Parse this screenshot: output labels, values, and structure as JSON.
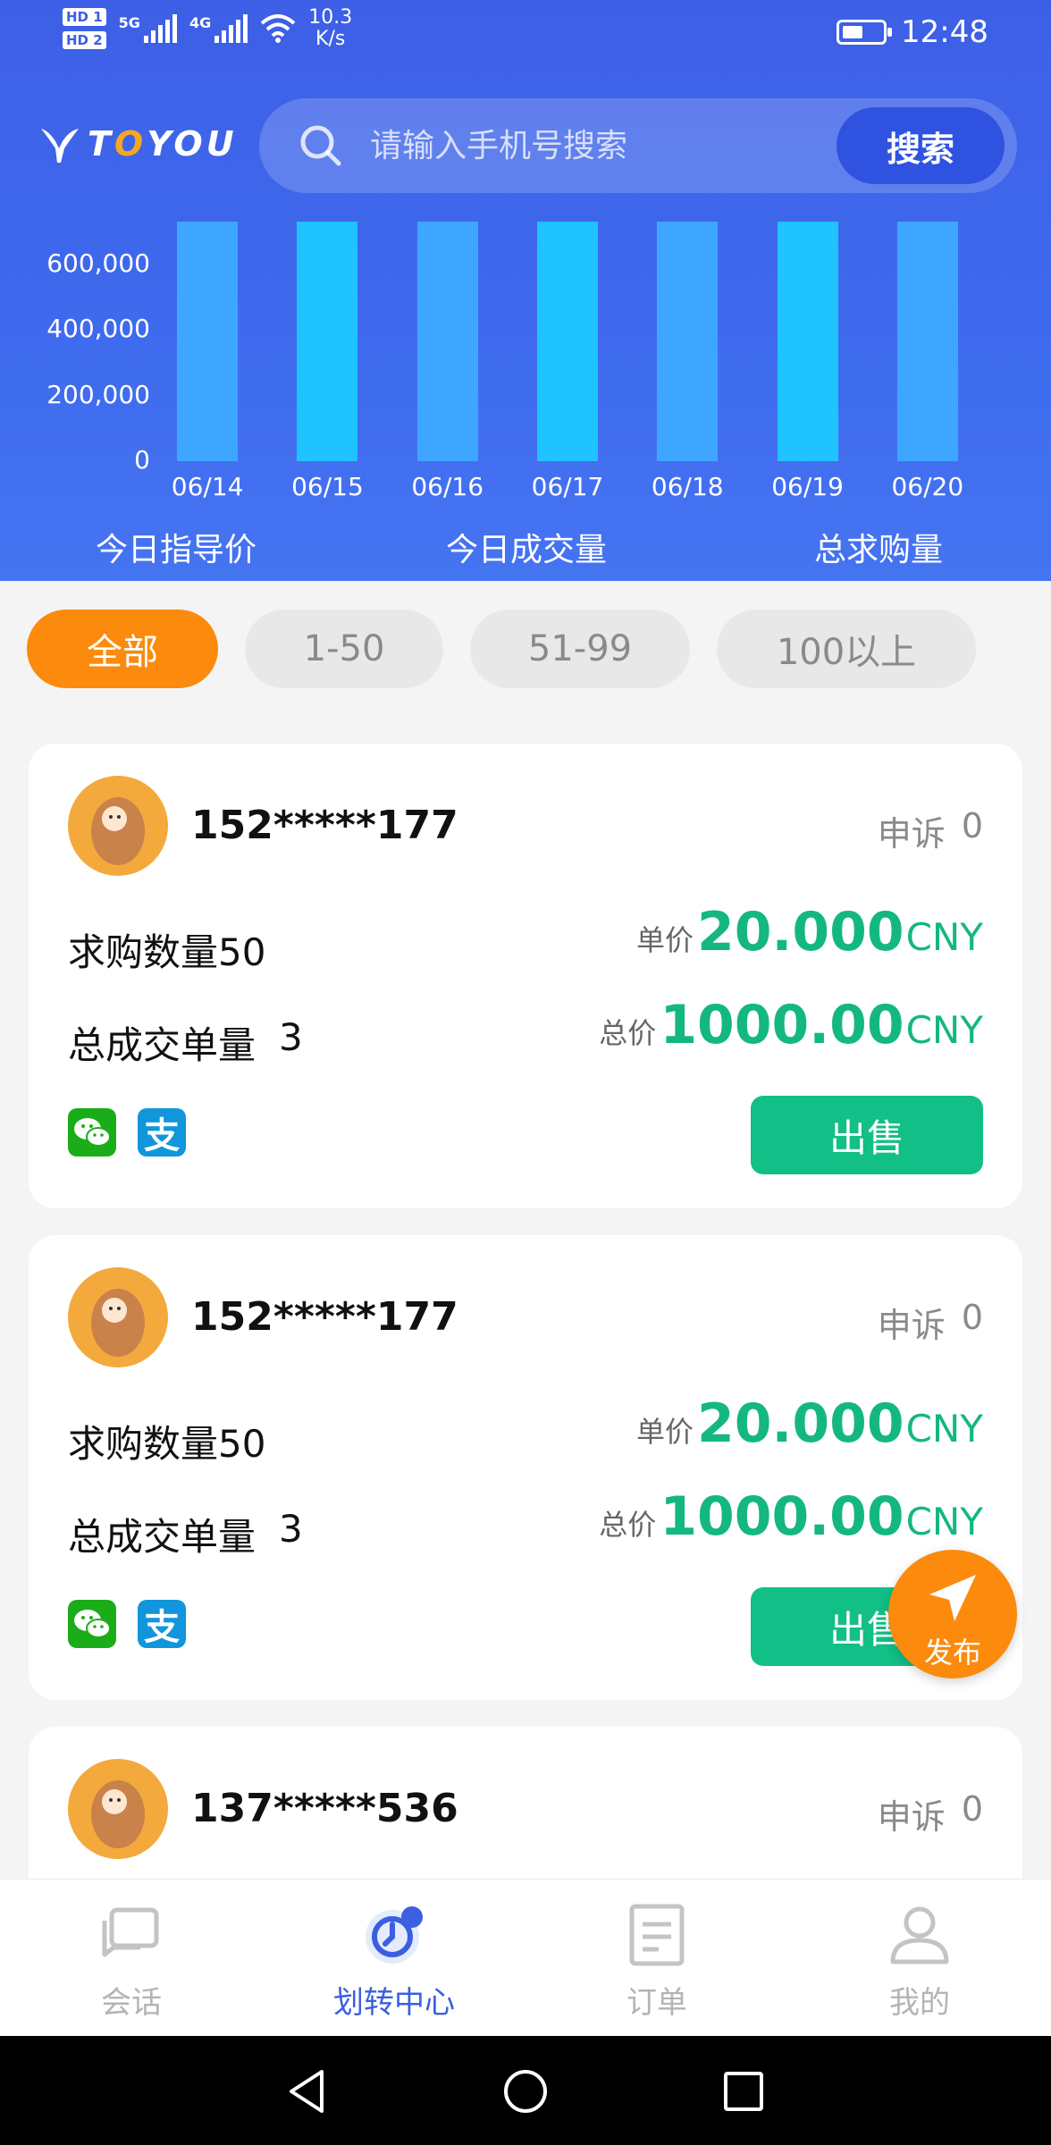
{
  "status_bar": {
    "hd1": "HD 1",
    "hd2": "HD 2",
    "sig1": "5G",
    "sig2": "4G",
    "speed_value": "10.3",
    "speed_unit": "K/s",
    "time": "12:48"
  },
  "brand": {
    "name_prefix": "T",
    "name_accent": "O",
    "name_suffix": "YOU"
  },
  "search": {
    "placeholder": "请输入手机号搜索",
    "button": "搜索"
  },
  "chart_data": {
    "type": "bar",
    "categories": [
      "06/14",
      "06/15",
      "06/16",
      "06/17",
      "06/18",
      "06/19",
      "06/20"
    ],
    "values": [
      730000,
      730000,
      730000,
      730000,
      730000,
      730000,
      730000
    ],
    "ylim": [
      0,
      730000
    ],
    "yticks": [
      "600,000",
      "400,000",
      "200,000",
      "0"
    ],
    "colors": [
      "#3fa6ff",
      "#1fc3ff",
      "#3fa6ff",
      "#1fc3ff",
      "#3fa6ff",
      "#1fc3ff",
      "#3fa6ff"
    ],
    "grid": false
  },
  "stats": [
    "今日指导价",
    "今日成交量",
    "总求购量"
  ],
  "filters": [
    "全部",
    "1-50",
    "51-99",
    "100以上"
  ],
  "listings": [
    {
      "phone": "152*****177",
      "complaint_label": "申诉",
      "complaint_count": "0",
      "qty_text": "求购数量50",
      "deals_label": "总成交单量",
      "deals_count": "3",
      "unit_label": "单价",
      "unit_price": "20.000",
      "currency": "CNY",
      "total_label": "总价",
      "total_price": "1000.00",
      "sell_label": "出售"
    },
    {
      "phone": "152*****177",
      "complaint_label": "申诉",
      "complaint_count": "0",
      "qty_text": "求购数量50",
      "deals_label": "总成交单量",
      "deals_count": "3",
      "unit_label": "单价",
      "unit_price": "20.000",
      "currency": "CNY",
      "total_label": "总价",
      "total_price": "1000.00",
      "sell_label": "出售"
    },
    {
      "phone": "137*****536",
      "complaint_label": "申诉",
      "complaint_count": "0"
    }
  ],
  "pay_alipay_char": "支",
  "fab_label": "发布",
  "bottom_nav": [
    "会话",
    "划转中心",
    "订单",
    "我的"
  ],
  "colors": {
    "primary": "#3d5fe6",
    "accent": "#fb8a0d",
    "green": "#12bf86"
  }
}
